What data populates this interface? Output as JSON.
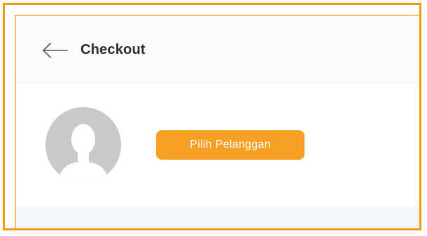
{
  "header": {
    "title": "Checkout",
    "back_icon": "arrow-left-icon"
  },
  "customer": {
    "avatar_icon": "user-silhouette-icon",
    "select_button_label": "Pilih Pelanggan"
  },
  "colors": {
    "accent": "#F5A023",
    "frame_border": "#F39C12",
    "avatar_gray": "#c9c9c9"
  }
}
